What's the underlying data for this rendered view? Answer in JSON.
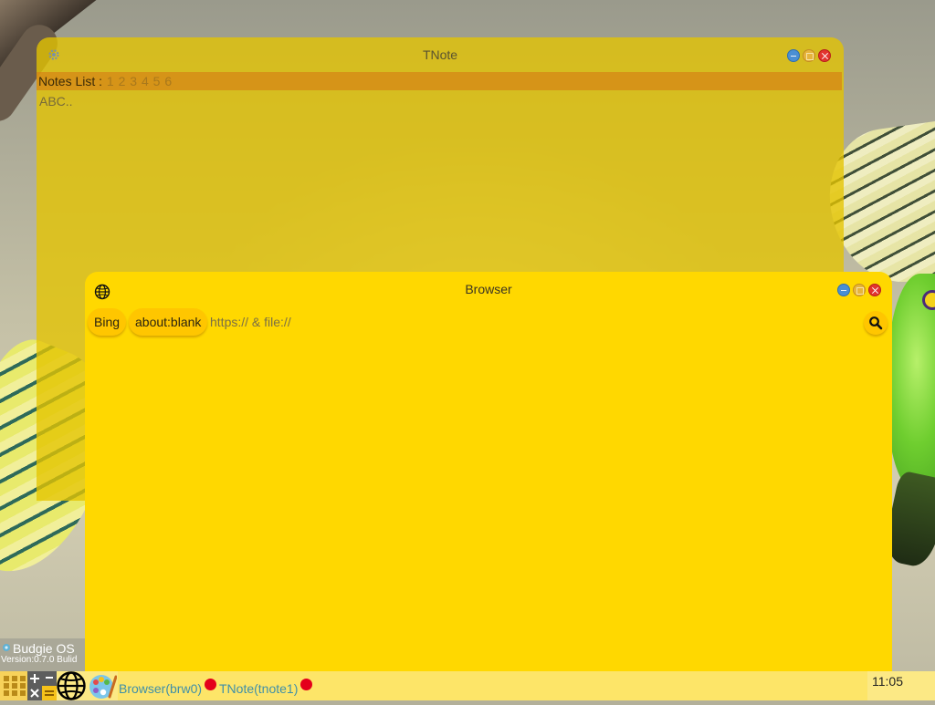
{
  "tnote": {
    "title": "TNote",
    "notes_label": "Notes List :",
    "note_numbers": [
      "1",
      "2",
      "3",
      "4",
      "5",
      "6"
    ],
    "body_text": "ABC.."
  },
  "browser": {
    "title": "Browser",
    "bookmarks": [
      "Bing",
      "about:blank"
    ],
    "url_placeholder": "https:// & file://",
    "url_value": ""
  },
  "os_badge": {
    "name": "Budgie OS",
    "version": "Version:0.7.0  Bulid"
  },
  "taskbar": {
    "launchers": [
      "apps-grid-icon",
      "calculator-icon",
      "browser-globe-icon",
      "paint-palette-icon"
    ],
    "tasks": [
      "Browser(brw0)",
      "TNote(tnote1)"
    ],
    "task_indicator_color": "#e4001b",
    "clock": "11:05"
  },
  "colors": {
    "tnote_window": "#e4c400",
    "notes_bar": "#d67a14",
    "browser_window": "#ffd800",
    "pill": "#ffc600",
    "taskbar": "#fce985"
  }
}
